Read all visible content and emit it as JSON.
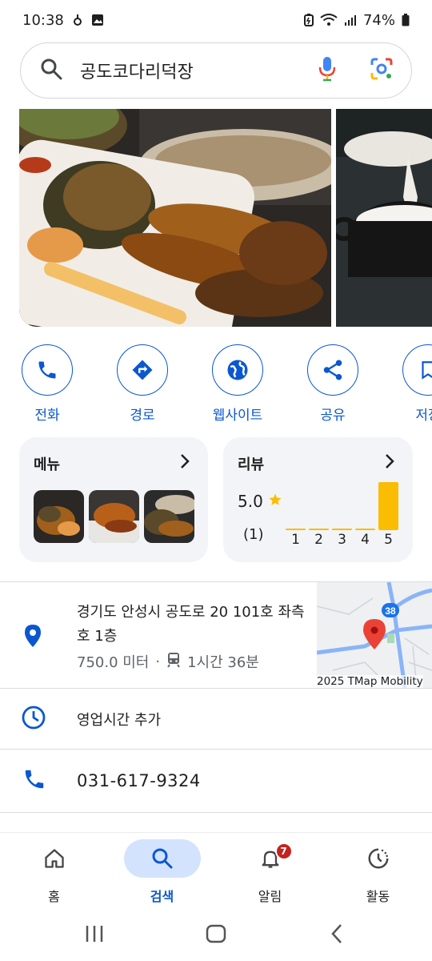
{
  "status_bar": {
    "time": "10:38",
    "battery": "74%",
    "icons": [
      "notification-icon",
      "image-icon",
      "battery-saver-icon",
      "wifi-icon",
      "signal-icon",
      "battery-icon"
    ]
  },
  "search": {
    "query": "공도코다리덕장",
    "icons": [
      "search-icon",
      "mic-icon",
      "lens-icon"
    ]
  },
  "actions": [
    {
      "label": "전화",
      "icon": "phone-icon"
    },
    {
      "label": "경로",
      "icon": "directions-icon"
    },
    {
      "label": "웹사이트",
      "icon": "globe-icon"
    },
    {
      "label": "공유",
      "icon": "share-icon"
    },
    {
      "label": "저장",
      "icon": "bookmark-icon"
    }
  ],
  "menu_card": {
    "title": "메뉴"
  },
  "review_card": {
    "title": "리뷰",
    "rating": "5.0",
    "count": "(1)",
    "distribution": [
      {
        "star": "1",
        "fraction": 0.0
      },
      {
        "star": "2",
        "fraction": 0.0
      },
      {
        "star": "3",
        "fraction": 0.0
      },
      {
        "star": "4",
        "fraction": 0.0
      },
      {
        "star": "5",
        "fraction": 1.0
      }
    ]
  },
  "address": {
    "line": "경기도 안성시 공도로 20 101호 좌측호 1층",
    "distance": "750.0 미터",
    "separator": "·",
    "transit_time": "1시간 36분",
    "map_attribution": "2025 TMap Mobility",
    "map_route_number": "38"
  },
  "hours": {
    "label": "영업시간 추가"
  },
  "phone": {
    "number": "031-617-9324"
  },
  "bottom_nav": [
    {
      "label": "홈",
      "icon": "home-icon",
      "active": false
    },
    {
      "label": "검색",
      "icon": "search-icon",
      "active": true
    },
    {
      "label": "알림",
      "icon": "bell-icon",
      "active": false,
      "badge": "7"
    },
    {
      "label": "활동",
      "icon": "activity-icon",
      "active": false
    }
  ],
  "colors": {
    "accent": "#0b57d0",
    "star": "#fbbc04",
    "badge": "#c5221f",
    "pin": "#ea4335"
  }
}
